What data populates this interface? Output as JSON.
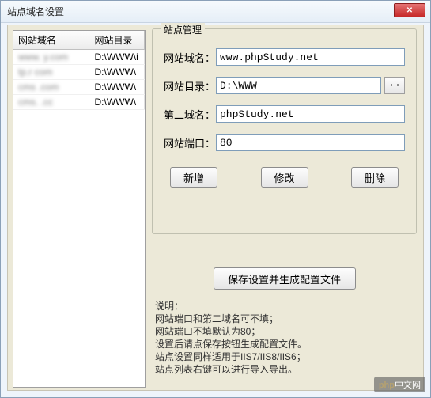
{
  "window": {
    "title": "站点域名设置",
    "close_tooltip": "关闭"
  },
  "table": {
    "headers": [
      "网站域名",
      "网站目录"
    ],
    "rows": [
      {
        "domain": "www.  y.com",
        "dir": "D:\\WWW\\i"
      },
      {
        "domain": "tp.r   com",
        "dir": "D:\\WWW\\"
      },
      {
        "domain": "cms   .com",
        "dir": "D:\\WWW\\"
      },
      {
        "domain": "cms.   .cc",
        "dir": "D:\\WWW\\"
      }
    ]
  },
  "panel": {
    "legend": "站点管理",
    "labels": {
      "domain": "网站域名：",
      "dir": "网站目录：",
      "second_domain": "第二域名：",
      "port": "网站端口："
    },
    "values": {
      "domain": "www.phpStudy.net",
      "dir": "D:\\WWW",
      "second_domain": "phpStudy.net",
      "port": "80"
    },
    "browse_label": "··",
    "buttons": {
      "add": "新增",
      "edit": "修改",
      "delete": "删除",
      "save": "保存设置并生成配置文件"
    }
  },
  "desc": {
    "l1": "说明：",
    "l2": "网站端口和第二域名可不填；",
    "l3": "网站端口不填默认为80；",
    "l4": "设置后请点保存按钮生成配置文件。",
    "l5": "站点设置同样适用于IIS7/IIS8/IIS6；",
    "l6": "站点列表右键可以进行导入导出。"
  },
  "watermark": {
    "php": "php",
    "cn": "中文网"
  }
}
